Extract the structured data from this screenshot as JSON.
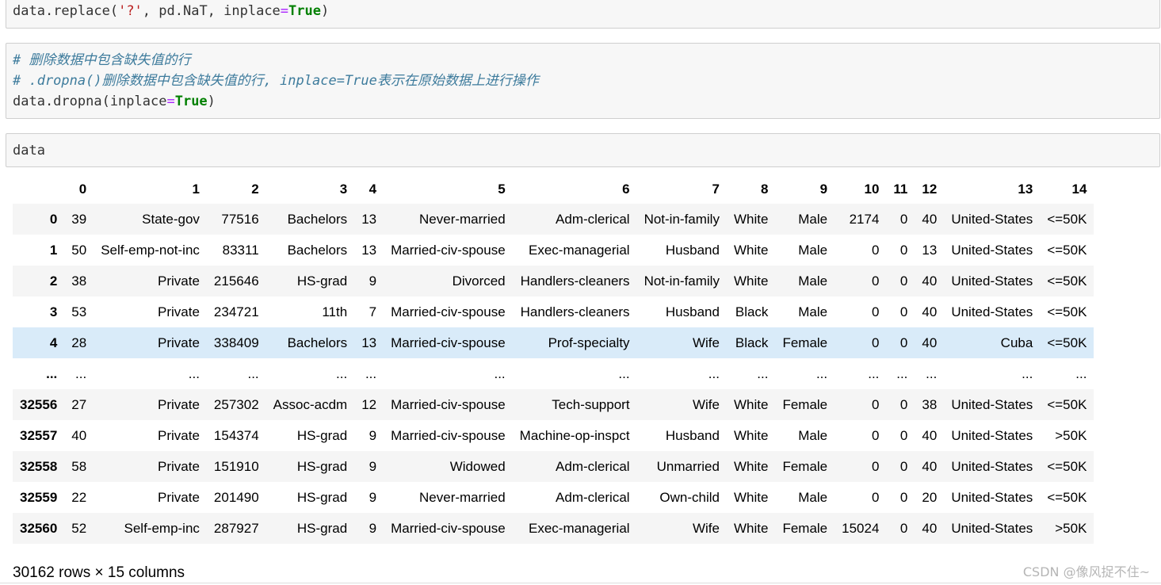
{
  "cells": {
    "replace": {
      "obj": "data",
      "method": ".replace(",
      "arg1": "'?'",
      "sep1": ", pd.NaT, inplace",
      "eq": "=",
      "val": "True",
      "close": ")"
    },
    "dropna": {
      "comment1": "# 删除数据中包含缺失值的行",
      "comment2": "# .dropna()删除数据中包含缺失值的行, inplace=True表示在原始数据上进行操作",
      "code_pre": "data.dropna(inplace",
      "eq": "=",
      "val": "True",
      "close": ")"
    },
    "display": {
      "code": "data"
    }
  },
  "dataframe": {
    "columns": [
      "",
      "0",
      "1",
      "2",
      "3",
      "4",
      "5",
      "6",
      "7",
      "8",
      "9",
      "10",
      "11",
      "12",
      "13",
      "14"
    ],
    "rows": [
      [
        "0",
        "39",
        "State-gov",
        "77516",
        "Bachelors",
        "13",
        "Never-married",
        "Adm-clerical",
        "Not-in-family",
        "White",
        "Male",
        "2174",
        "0",
        "40",
        "United-States",
        "<=50K"
      ],
      [
        "1",
        "50",
        "Self-emp-not-inc",
        "83311",
        "Bachelors",
        "13",
        "Married-civ-spouse",
        "Exec-managerial",
        "Husband",
        "White",
        "Male",
        "0",
        "0",
        "13",
        "United-States",
        "<=50K"
      ],
      [
        "2",
        "38",
        "Private",
        "215646",
        "HS-grad",
        "9",
        "Divorced",
        "Handlers-cleaners",
        "Not-in-family",
        "White",
        "Male",
        "0",
        "0",
        "40",
        "United-States",
        "<=50K"
      ],
      [
        "3",
        "53",
        "Private",
        "234721",
        "11th",
        "7",
        "Married-civ-spouse",
        "Handlers-cleaners",
        "Husband",
        "Black",
        "Male",
        "0",
        "0",
        "40",
        "United-States",
        "<=50K"
      ],
      [
        "4",
        "28",
        "Private",
        "338409",
        "Bachelors",
        "13",
        "Married-civ-spouse",
        "Prof-specialty",
        "Wife",
        "Black",
        "Female",
        "0",
        "0",
        "40",
        "Cuba",
        "<=50K"
      ],
      [
        "...",
        "...",
        "...",
        "...",
        "...",
        "...",
        "...",
        "...",
        "...",
        "...",
        "...",
        "...",
        "...",
        "...",
        "...",
        "..."
      ],
      [
        "32556",
        "27",
        "Private",
        "257302",
        "Assoc-acdm",
        "12",
        "Married-civ-spouse",
        "Tech-support",
        "Wife",
        "White",
        "Female",
        "0",
        "0",
        "38",
        "United-States",
        "<=50K"
      ],
      [
        "32557",
        "40",
        "Private",
        "154374",
        "HS-grad",
        "9",
        "Married-civ-spouse",
        "Machine-op-inspct",
        "Husband",
        "White",
        "Male",
        "0",
        "0",
        "40",
        "United-States",
        ">50K"
      ],
      [
        "32558",
        "58",
        "Private",
        "151910",
        "HS-grad",
        "9",
        "Widowed",
        "Adm-clerical",
        "Unmarried",
        "White",
        "Female",
        "0",
        "0",
        "40",
        "United-States",
        "<=50K"
      ],
      [
        "32559",
        "22",
        "Private",
        "201490",
        "HS-grad",
        "9",
        "Never-married",
        "Adm-clerical",
        "Own-child",
        "White",
        "Male",
        "0",
        "0",
        "20",
        "United-States",
        "<=50K"
      ],
      [
        "32560",
        "52",
        "Self-emp-inc",
        "287927",
        "HS-grad",
        "9",
        "Married-civ-spouse",
        "Exec-managerial",
        "Wife",
        "White",
        "Female",
        "15024",
        "0",
        "40",
        "United-States",
        ">50K"
      ]
    ],
    "highlighted_row": 4,
    "shape_text": "30162 rows × 15 columns"
  },
  "watermark": "CSDN @像风捉不住~",
  "colors": {
    "cell_bg": "#f7f7f7",
    "keyword_green": "#008000",
    "comment_teal": "#3d7b9c",
    "string_red": "#ba2121",
    "operator_purple": "#aa22ff",
    "row_highlight": "#d9ebf9"
  }
}
